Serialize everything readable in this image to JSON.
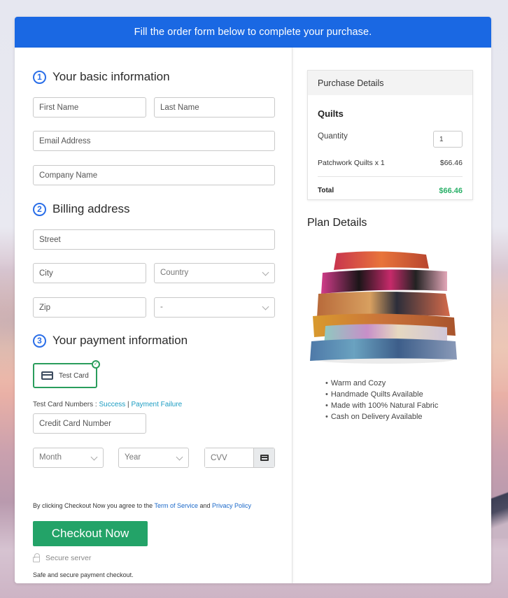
{
  "banner": {
    "text": "Fill the order form below to complete your purchase."
  },
  "sections": {
    "basic": {
      "number": "1",
      "title": "Your basic information"
    },
    "billing": {
      "number": "2",
      "title": "Billing address"
    },
    "payment": {
      "number": "3",
      "title": "Your payment information"
    }
  },
  "fields": {
    "first_name": {
      "placeholder": "First Name",
      "value": ""
    },
    "last_name": {
      "placeholder": "Last Name",
      "value": ""
    },
    "email": {
      "placeholder": "Email Address",
      "value": ""
    },
    "company": {
      "placeholder": "Company Name",
      "value": ""
    },
    "street": {
      "placeholder": "Street",
      "value": ""
    },
    "city": {
      "placeholder": "City",
      "value": ""
    },
    "country": {
      "selected": "Country"
    },
    "zip": {
      "placeholder": "Zip",
      "value": ""
    },
    "state": {
      "selected": "-"
    },
    "card_number": {
      "placeholder": "Credit Card Number",
      "value": ""
    },
    "month": {
      "selected": "Month"
    },
    "year": {
      "selected": "Year"
    },
    "cvv": {
      "placeholder": "CVV",
      "value": ""
    }
  },
  "payment": {
    "method_label": "Test Card",
    "test_numbers_label": "Test Card Numbers : ",
    "success_link": "Success",
    "separator": " | ",
    "failure_link": "Payment Failure"
  },
  "terms": {
    "prefix": "By clicking Checkout Now you agree to the ",
    "tos_link": "Term of Service",
    "and": " and ",
    "privacy_link": "Privacy Policy"
  },
  "checkout": {
    "button_label": "Checkout Now",
    "secure_label": "Secure server",
    "safe_note": "Safe and secure payment checkout."
  },
  "purchase": {
    "header": "Purchase Details",
    "product": "Quilts",
    "quantity_label": "Quantity",
    "quantity_value": "1",
    "line_item": "Patchwork Quilts x 1",
    "line_price": "$66.46",
    "total_label": "Total",
    "total_value": "$66.46"
  },
  "plan": {
    "title": "Plan Details",
    "image_alt": "Stack of colorful patchwork quilts",
    "features": [
      "Warm and Cozy",
      "Handmade Quilts Available",
      "Made with 100% Natural Fabric",
      "Cash on Delivery Available"
    ]
  },
  "colors": {
    "banner": "#1a68e3",
    "accent_blue": "#2a6ee8",
    "checkout_green": "#23a368",
    "total_green": "#2ab068",
    "link_teal": "#1a9cc2"
  }
}
